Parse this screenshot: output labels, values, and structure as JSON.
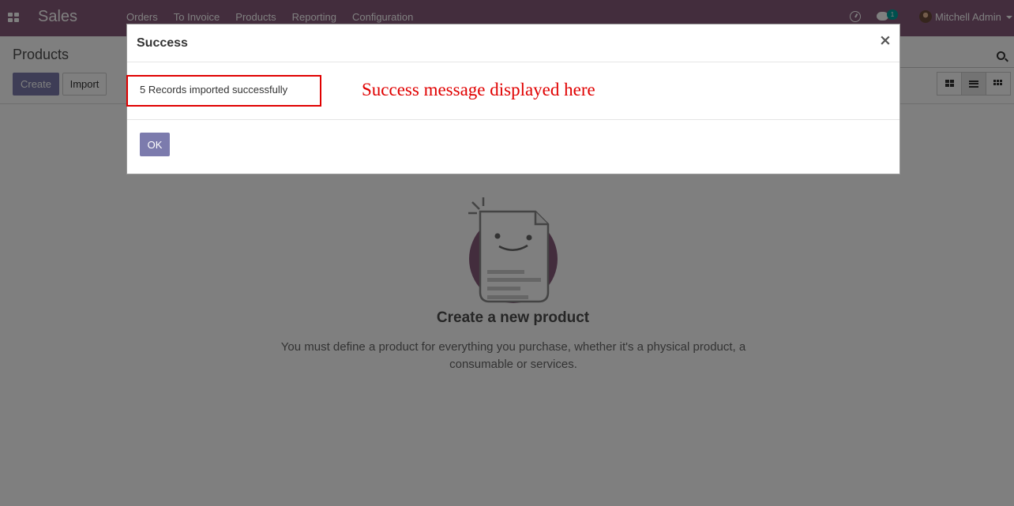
{
  "navbar": {
    "app_name": "Sales",
    "menu": [
      "Orders",
      "To Invoice",
      "Products",
      "Reporting",
      "Configuration"
    ],
    "chat_badge_count": "1",
    "user_name": "Mitchell Admin"
  },
  "control_panel": {
    "breadcrumb": "Products",
    "create_label": "Create",
    "import_label": "Import"
  },
  "helper": {
    "title": "Create a new product",
    "text": "You must define a product for everything you purchase, whether it's a physical product, a consumable or services."
  },
  "modal": {
    "title": "Success",
    "close_symbol": "×",
    "message": "5 Records imported successfully",
    "annotation": "Success message displayed here",
    "ok_label": "OK"
  },
  "colors": {
    "navbar": "#875a7b",
    "primary_button": "#7c7bad",
    "annotation_red": "#e00000",
    "badge_teal": "#00a09d"
  }
}
